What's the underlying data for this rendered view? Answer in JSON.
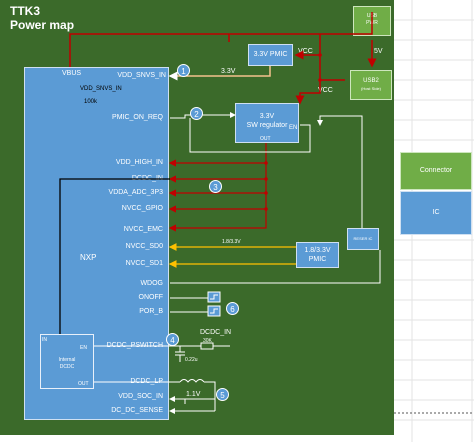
{
  "board": {
    "title": "TTK3",
    "subtitle": "Power map"
  },
  "blocks": {
    "soc": {
      "vbus": "VBUS",
      "name": "NXP"
    },
    "pmic33": {
      "label": "3.3V PMIC",
      "vcc": "VCC"
    },
    "sw_reg": {
      "line1": "3.3V",
      "line2": "SW regulator",
      "en": "EN",
      "out": "OUT"
    },
    "usb_pwr": {
      "line1": "USB",
      "line2": "PWR"
    },
    "usb2": {
      "line1": "USB2",
      "line2": "(Host Side)",
      "input": "5V",
      "vcc": "VCC"
    },
    "pmic18": {
      "line1": "1.8/3.3V",
      "line2": "PMIC"
    },
    "reset_ic": {
      "label": "RESER IC"
    },
    "dcdc": {
      "in": "IN",
      "en": "EN",
      "line1": "Internal",
      "line2": "DCDC",
      "out": "OUT"
    }
  },
  "pins": [
    "VDD_SNVS_IN",
    "PMIC_ON_REQ",
    "VDD_HIGH_IN",
    "DCDC_IN",
    "VDDA_ADC_3P3",
    "NVCC_GPIO",
    "NVCC_EMC",
    "NVCC_SD0",
    "NVCC_SD1",
    "WDOG",
    "ONOFF",
    "POR_B",
    "DCDC_PSWITCH",
    "DCDC_LP",
    "VDD_SOC_IN",
    "DC_DC_SENSE"
  ],
  "annotations": {
    "vdd_snvs_net": "VDD_SNVS_IN",
    "resistor": "100k",
    "v33": "3.3V",
    "sd_voltage": "1.8/3.3V",
    "dcdc_in_label": "DCDC_IN",
    "r30k": "30K",
    "cap": "0.22u",
    "v11": "1.1V"
  },
  "markers": [
    "1",
    "2",
    "3",
    "4",
    "5",
    "6"
  ],
  "legend": {
    "connector": "Connector",
    "ic": "IC"
  },
  "colors": {
    "board": "#3b6a2a",
    "ic": "#5b9bd5",
    "connector": "#70ad47",
    "power": "#c00000",
    "io": "#ffc000",
    "signal": "#000000"
  }
}
